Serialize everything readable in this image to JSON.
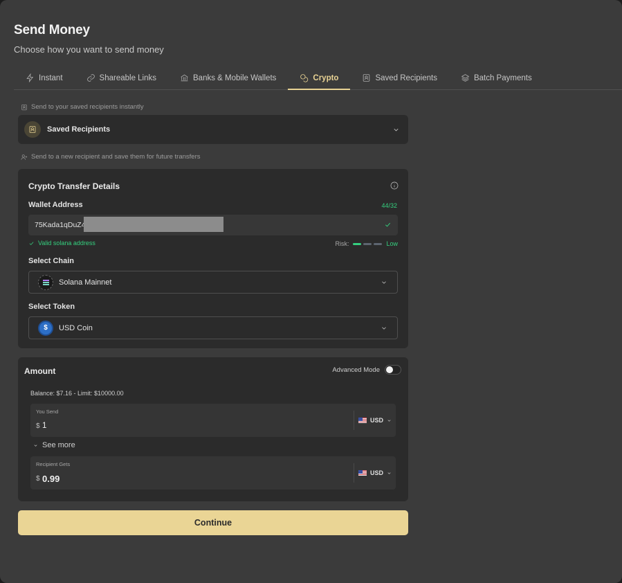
{
  "header": {
    "title": "Send Money",
    "subtitle": "Choose how you want to send money"
  },
  "tabs": [
    {
      "label": "Instant",
      "icon": "bolt-icon",
      "active": false
    },
    {
      "label": "Shareable Links",
      "icon": "link-icon",
      "active": false
    },
    {
      "label": "Banks & Mobile Wallets",
      "icon": "bank-icon",
      "active": false
    },
    {
      "label": "Crypto",
      "icon": "coins-icon",
      "active": true
    },
    {
      "label": "Saved Recipients",
      "icon": "contact-icon",
      "active": false
    },
    {
      "label": "Batch Payments",
      "icon": "layers-icon",
      "active": false
    }
  ],
  "saved": {
    "hint": "Send to your saved recipients instantly",
    "dropdown_label": "Saved Recipients"
  },
  "new_recipient_hint": "Send to a new recipient and save them for future transfers",
  "crypto": {
    "title": "Crypto Transfer Details",
    "wallet_label": "Wallet Address",
    "wallet_counter": "44/32",
    "wallet_value": "75Kada1qDuZ4",
    "valid_message": "Valid solana address",
    "risk_label": "Risk:",
    "risk_level": "Low",
    "chain_label": "Select Chain",
    "chain_value": "Solana Mainnet",
    "token_label": "Select Token",
    "token_value": "USD Coin"
  },
  "amount": {
    "title": "Amount",
    "advanced_label": "Advanced Mode",
    "advanced_on": false,
    "balance": "Balance: $7.16 - Limit: $10000.00",
    "send_label": "You Send",
    "send_symbol": "$",
    "send_value": "1",
    "send_currency": "USD",
    "see_more": "See more",
    "receive_label": "Recipient Gets",
    "receive_symbol": "$",
    "receive_value": "0.99",
    "receive_currency": "USD"
  },
  "actions": {
    "continue_label": "Continue"
  },
  "colors": {
    "accent": "#e9d394",
    "success": "#35d07f",
    "background": "#3b3b3b",
    "panel": "#2b2b2b"
  }
}
